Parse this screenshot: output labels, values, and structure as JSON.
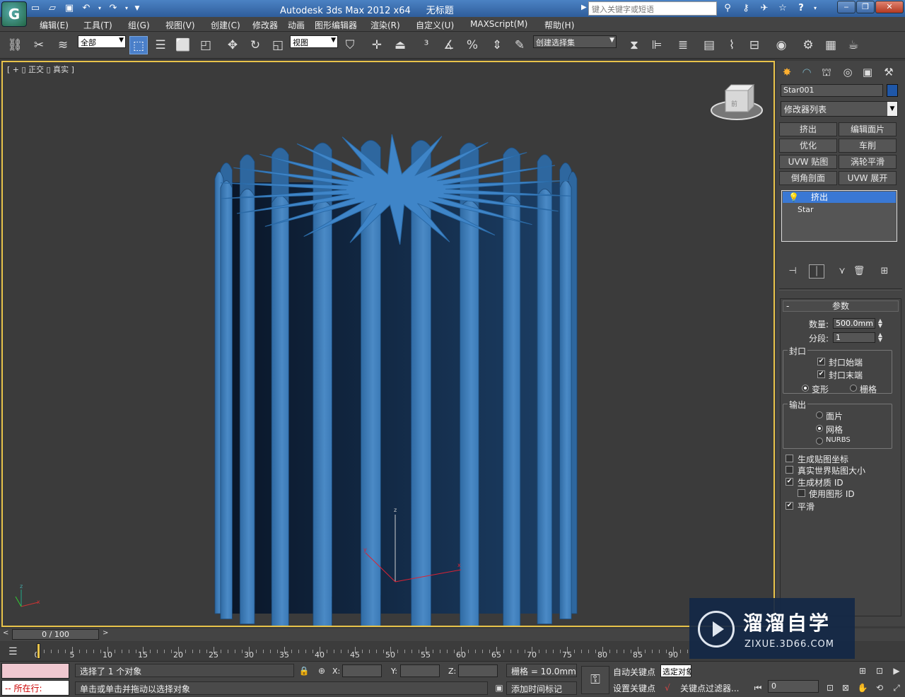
{
  "titlebar": {
    "app_name": "Autodesk 3ds Max  2012 x64",
    "doc_title": "无标题",
    "search_placeholder": "键入关键字或短语"
  },
  "menu": [
    "编辑(E)",
    "工具(T)",
    "组(G)",
    "视图(V)",
    "创建(C)",
    "修改器",
    "动画",
    "图形编辑器",
    "渲染(R)",
    "自定义(U)",
    "MAXScript(M)",
    "帮助(H)"
  ],
  "toolbar": {
    "filter_value": "全部",
    "ref_coord_value": "视图",
    "named_selection_placeholder": "创建选择集"
  },
  "viewport": {
    "label": "[ + ▯ 正交 ▯ 真实 ]",
    "object_color": "#3d7fc0"
  },
  "command_panel": {
    "object_name": "Star001",
    "object_color": "#1f57a8",
    "modifier_list": "修改器列表",
    "mod_buttons": [
      "挤出",
      "编辑面片",
      "优化",
      "车削",
      "UVW 贴图",
      "涡轮平滑",
      "倒角剖面",
      "UVW 展开"
    ],
    "stack": {
      "selected": "挤出",
      "base": "Star"
    },
    "params": {
      "title": "参数",
      "amount_label": "数量:",
      "amount_value": "500.0mm",
      "segments_label": "分段:",
      "segments_value": "1",
      "capping_title": "封口",
      "cap_start": "封口始端",
      "cap_end": "封口末端",
      "morph": "变形",
      "grid": "栅格",
      "output_title": "输出",
      "patch": "面片",
      "mesh": "网格",
      "nurbs": "NURBS",
      "gen_map_coords": "生成贴图坐标",
      "real_world": "真实世界贴图大小",
      "gen_mat_ids": "生成材质 ID",
      "use_shape_ids": "使用图形 ID",
      "smooth": "平滑"
    }
  },
  "timeline": {
    "slider_text": "0 / 100",
    "ticks": [
      "0",
      "5",
      "10",
      "15",
      "20",
      "25",
      "30",
      "35",
      "40",
      "45",
      "50",
      "55",
      "60",
      "65",
      "70",
      "75",
      "80",
      "85",
      "90"
    ]
  },
  "status": {
    "maxscript_line": "-- 所在行:",
    "selection_msg": "选择了 1 个对象",
    "prompt_msg": "单击或单击并拖动以选择对象",
    "x_label": "X:",
    "y_label": "Y:",
    "z_label": "Z:",
    "grid_text": "栅格 = 10.0mm",
    "add_time_tag": "添加时间标记",
    "auto_key": "自动关键点",
    "set_key": "设置关键点",
    "selected_dropdown": "选定对象",
    "key_filters": "关键点过滤器...",
    "frame_value": "0"
  },
  "watermark": {
    "name": "溜溜自学",
    "url": "ZIXUE.3D66.COM"
  }
}
